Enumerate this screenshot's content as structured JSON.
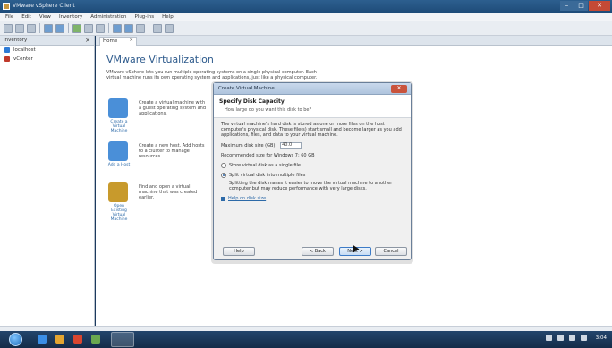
{
  "window": {
    "title": "VMware vSphere Client",
    "buttons": [
      "–",
      "□",
      "✕"
    ]
  },
  "menu": [
    "File",
    "Edit",
    "View",
    "Inventory",
    "Administration",
    "Plug-ins",
    "Help"
  ],
  "sidebar": {
    "header": "Inventory",
    "items": [
      {
        "label": "localhost",
        "color": "#2e7bd6"
      },
      {
        "label": "vCenter",
        "color": "#c0392b"
      }
    ]
  },
  "main": {
    "tab": "Home",
    "title": "VMware Virtualization",
    "intro": "VMware vSphere lets you run multiple operating systems on a single physical computer. Each virtual machine runs its own operating system and applications, just like a physical computer.",
    "features": [
      {
        "label": "Create a Virtual Machine",
        "text": "Create a virtual machine with a guest operating system and applications.",
        "color": "#4a8fd8"
      },
      {
        "label": "Add a Host",
        "text": "Create a new host. Add hosts to a cluster to manage resources.",
        "color": "#4a8fd8"
      },
      {
        "label": "Open Existing Virtual Machine",
        "text": "Find and open a virtual machine that was created earlier.",
        "color": "#c89a2c"
      }
    ]
  },
  "dialog": {
    "title": "Create Virtual Machine",
    "close": "✕",
    "header_title": "Specify Disk Capacity",
    "header_sub": "How large do you want this disk to be?",
    "description": "The virtual machine's hard disk is stored as one or more files on the host computer's physical disk. These file(s) start small and become larger as you add applications, files, and data to your virtual machine.",
    "size_label": "Maximum disk size (GB):",
    "size_value": "40.0",
    "recommended": "Recommended size for Windows 7: 60 GB",
    "option_single": "Store virtual disk as a single file",
    "option_split": "Split virtual disk into multiple files",
    "split_help": "Splitting the disk makes it easier to move the virtual machine to another computer but may reduce performance with very large disks.",
    "link": "Help on disk size",
    "buttons": {
      "help": "Help",
      "back": "< Back",
      "next": "Next >",
      "cancel": "Cancel"
    }
  },
  "taskbar": {
    "clock": "3:04"
  }
}
